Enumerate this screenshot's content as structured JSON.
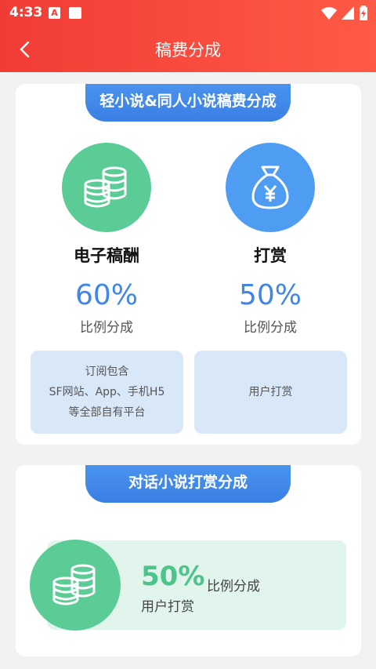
{
  "status": {
    "time": "4:33"
  },
  "appbar": {
    "title": "稿费分成"
  },
  "section1": {
    "tab": "轻小说&同人小说稿费分成",
    "left": {
      "title": "电子稿酬",
      "percent": "60%",
      "sub": "比例分成",
      "icon": "coins-icon",
      "color": "#5ccc96"
    },
    "right": {
      "title": "打赏",
      "percent": "50%",
      "sub": "比例分成",
      "icon": "money-bag-icon",
      "color": "#4e9df2"
    },
    "left_box": [
      "订阅包含",
      "SF网站、App、手机H5",
      "等全部自有平台"
    ],
    "right_box": "用户打赏"
  },
  "section2": {
    "tab": "对话小说打赏分成",
    "percent": "50%",
    "sub": "比例分成",
    "note": "用户打赏",
    "icon": "coins-icon"
  }
}
